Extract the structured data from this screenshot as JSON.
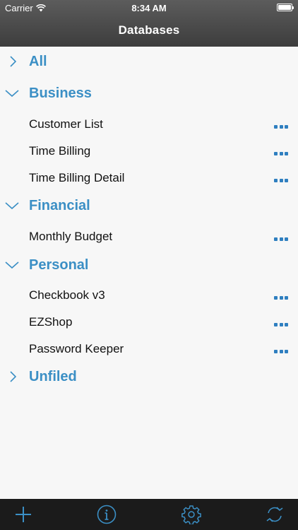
{
  "status_bar": {
    "carrier": "Carrier",
    "time": "8:34 AM"
  },
  "nav": {
    "title": "Databases"
  },
  "list": {
    "sections": [
      {
        "label": "All",
        "expanded": false,
        "items": []
      },
      {
        "label": "Business",
        "expanded": true,
        "items": [
          "Customer List",
          "Time Billing",
          "Time Billing Detail"
        ]
      },
      {
        "label": "Financial",
        "expanded": true,
        "items": [
          "Monthly Budget"
        ]
      },
      {
        "label": "Personal",
        "expanded": true,
        "items": [
          "Checkbook v3",
          "EZShop",
          "Password Keeper"
        ]
      },
      {
        "label": "Unfiled",
        "expanded": false,
        "items": []
      }
    ]
  },
  "toolbar": {
    "icons": [
      "add-icon",
      "info-icon",
      "settings-icon",
      "sync-icon"
    ]
  },
  "colors": {
    "accent": "#3b8fc5",
    "nav_bar": "#4a4a4a",
    "toolbar": "#1b1b1b",
    "background": "#f7f7f7"
  }
}
